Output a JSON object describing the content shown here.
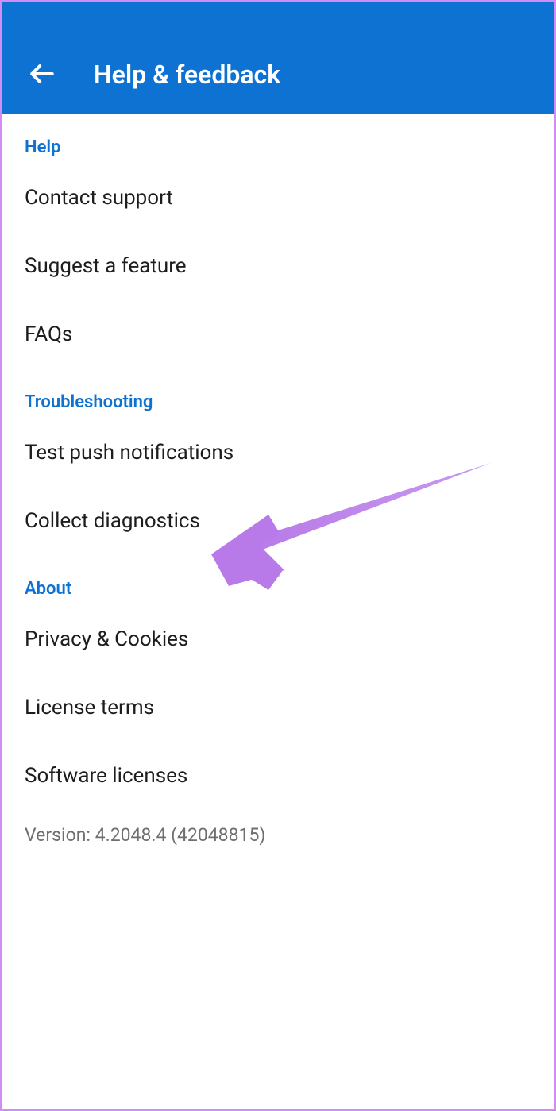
{
  "header": {
    "title": "Help & feedback"
  },
  "sections": {
    "help": {
      "label": "Help",
      "items": {
        "contact": "Contact support",
        "suggest": "Suggest a feature",
        "faqs": "FAQs"
      }
    },
    "troubleshooting": {
      "label": "Troubleshooting",
      "items": {
        "testpush": "Test push notifications",
        "collect": "Collect diagnostics"
      }
    },
    "about": {
      "label": "About",
      "items": {
        "privacy": "Privacy & Cookies",
        "license": "License terms",
        "software": "Software licenses"
      }
    }
  },
  "version": "Version: 4.2048.4 (42048815)"
}
